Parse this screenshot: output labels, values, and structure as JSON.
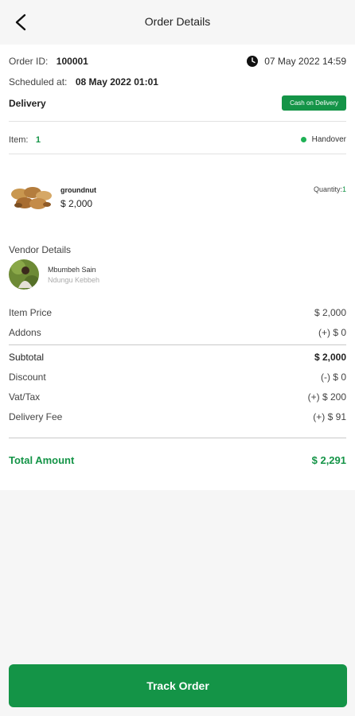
{
  "header": {
    "title": "Order Details"
  },
  "order": {
    "id_label": "Order ID:",
    "id_value": "100001",
    "date": "07 May 2022  14:59",
    "scheduled_label": "Scheduled at:",
    "scheduled_value": "08 May 2022  01:01",
    "delivery_label": "Delivery",
    "payment_badge": "Cash on Delivery"
  },
  "items_summary": {
    "item_label": "Item:",
    "item_count": "1",
    "status": "Handover"
  },
  "item": {
    "name": "groundnut",
    "price": "$ 2,000",
    "quantity_label": "Quantity:",
    "quantity_value": "1"
  },
  "vendor": {
    "section_title": "Vendor Details",
    "name": "Mbumbeh Sain",
    "location": "Ndungu Kebbeh"
  },
  "pricing": {
    "item_price_label": "Item Price",
    "item_price_value": "$ 2,000",
    "addons_label": "Addons",
    "addons_value": "(+) $ 0",
    "subtotal_label": "Subtotal",
    "subtotal_value": "$ 2,000",
    "discount_label": "Discount",
    "discount_value": "(-) $ 0",
    "vat_label": "Vat/Tax",
    "vat_value": "(+) $ 200",
    "delivery_fee_label": "Delivery Fee",
    "delivery_fee_value": "(+) $ 91",
    "total_label": "Total Amount",
    "total_value": "$ 2,291"
  },
  "actions": {
    "track_label": "Track Order"
  },
  "colors": {
    "accent": "#149447",
    "status_dot": "#1fb155"
  },
  "icons": {
    "back": "back-arrow-icon",
    "clock": "clock-icon"
  }
}
